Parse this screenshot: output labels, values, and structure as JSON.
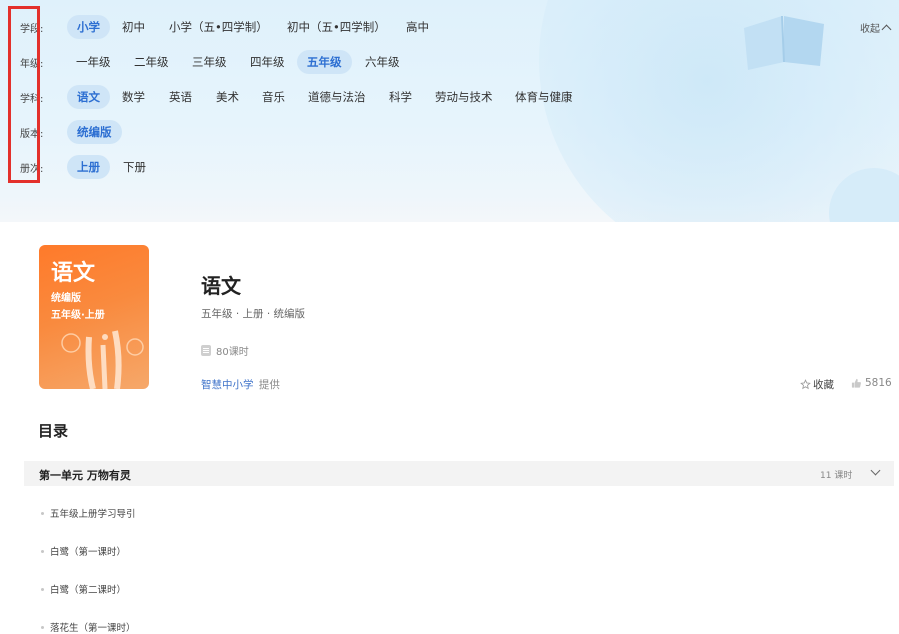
{
  "filters": {
    "stage": {
      "label": "学段:",
      "options": [
        "小学",
        "初中",
        "小学（五•四学制）",
        "初中（五•四学制）",
        "高中"
      ],
      "selected": "小学"
    },
    "grade": {
      "label": "年级:",
      "options": [
        "一年级",
        "二年级",
        "三年级",
        "四年级",
        "五年级",
        "六年级"
      ],
      "selected": "五年级"
    },
    "subject": {
      "label": "学科:",
      "options": [
        "语文",
        "数学",
        "英语",
        "美术",
        "音乐",
        "道德与法治",
        "科学",
        "劳动与技术",
        "体育与健康"
      ],
      "selected": "语文"
    },
    "edition": {
      "label": "版本:",
      "options": [
        "统编版"
      ],
      "selected": "统编版"
    },
    "volume": {
      "label": "册次:",
      "options": [
        "上册",
        "下册"
      ],
      "selected": "上册"
    },
    "collapse_label": "收起"
  },
  "book": {
    "cover_title": "语文",
    "cover_edition": "统编版",
    "cover_grade": "五年级·上册",
    "title": "语文",
    "meta": "五年级 · 上册 · 统编版",
    "lessons": "80课时",
    "provider_name": "智慧中小学",
    "provider_suffix": "提供",
    "favorite_label": "收藏",
    "likes": "5816"
  },
  "toc": {
    "title": "目录",
    "unit": {
      "title": "第一单元 万物有灵",
      "count": "11 课时"
    },
    "lessons": [
      "五年级上册学习导引",
      "白鹭（第一课时）",
      "白鹭（第二课时）",
      "落花生（第一课时）"
    ]
  },
  "colors": {
    "accent": "#2d6fd2",
    "selected_bg": "#cfe5f7",
    "highlight_box": "#e3302b",
    "cover_orange": "#ff7a2a"
  }
}
